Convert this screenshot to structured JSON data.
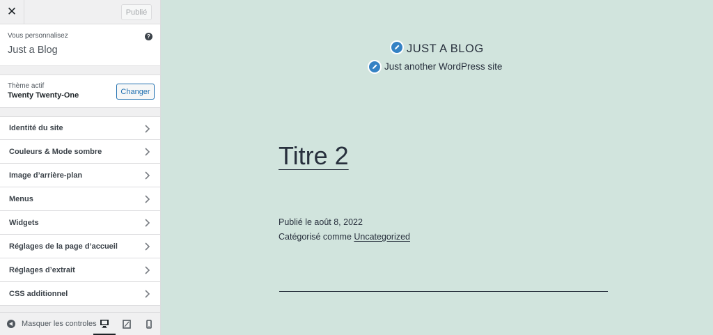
{
  "header": {
    "close_label": "✕",
    "publish_label": "Publié"
  },
  "info": {
    "pre_label": "Vous personnalisez",
    "site_name": "Just a Blog",
    "help_label": "?"
  },
  "theme": {
    "active_label": "Thème actif",
    "name": "Twenty Twenty-One",
    "change_label": "Changer"
  },
  "menu": {
    "items": [
      {
        "label": "Identité du site"
      },
      {
        "label": "Couleurs & Mode sombre"
      },
      {
        "label": "Image d’arrière-plan"
      },
      {
        "label": "Menus"
      },
      {
        "label": "Widgets"
      },
      {
        "label": "Réglages de la page d’accueil"
      },
      {
        "label": "Réglages d’extrait"
      },
      {
        "label": "CSS additionnel"
      }
    ]
  },
  "footer": {
    "hide_label": "Masquer les controles",
    "active_device": "desktop"
  },
  "preview": {
    "site_title": "JUST A BLOG",
    "tagline": "Just another WordPress site",
    "post_title": "Titre 2",
    "published_line": "Publié le août 8, 2022",
    "category_prefix": "Catégorisé comme ",
    "category_link": "Uncategorized"
  },
  "colors": {
    "preview_bg": "#d1e4dd",
    "accent": "#2271b1",
    "shortcut": "#3582c4"
  }
}
